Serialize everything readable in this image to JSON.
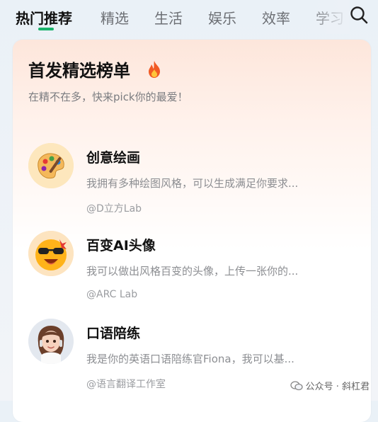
{
  "tabs": [
    {
      "label": "热门推荐",
      "active": true
    },
    {
      "label": "精选",
      "active": false
    },
    {
      "label": "生活",
      "active": false
    },
    {
      "label": "娱乐",
      "active": false
    },
    {
      "label": "效率",
      "active": false
    },
    {
      "label": "学习",
      "active": false
    }
  ],
  "card": {
    "title": "首发精选榜单",
    "subtitle": "在精不在多，快来pick你的最爱！"
  },
  "items": [
    {
      "title": "创意绘画",
      "desc": "我拥有多种绘图风格，可以生成满足你要求...",
      "author": "@D立方Lab",
      "avatar_icon": "palette-icon"
    },
    {
      "title": "百变AI头像",
      "desc": "我可以做出风格百变的头像，上传一张你的...",
      "author": "@ARC Lab",
      "avatar_icon": "cool-emoji-icon"
    },
    {
      "title": "口语陪练",
      "desc": "我是你的英语口语陪练官Fiona，我可以基...",
      "author": "@语言翻译工作室",
      "avatar_icon": "girl-avatar-icon"
    }
  ],
  "watermark": {
    "text": "公众号 · 斜杠君"
  },
  "colors": {
    "accent": "#1ab36b",
    "card_top": "#fde6db"
  }
}
